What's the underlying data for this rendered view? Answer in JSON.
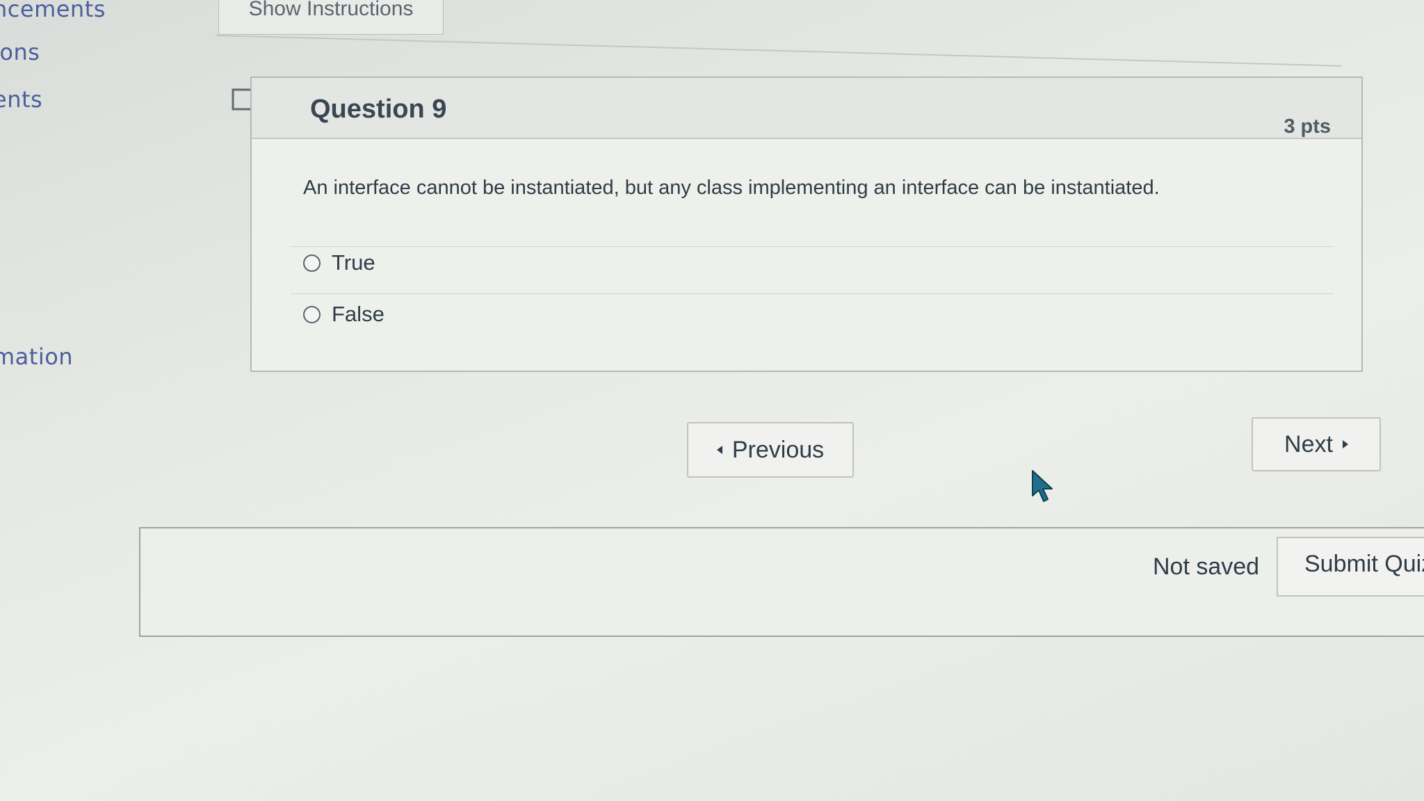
{
  "sidebar": {
    "items": [
      {
        "label": "ncements"
      },
      {
        "label": "ions"
      },
      {
        "label": "ents"
      },
      {
        "label": "mation"
      }
    ]
  },
  "quiz": {
    "show_instructions_label": "Show Instructions",
    "question": {
      "title": "Question 9",
      "points": "3 pts",
      "text": "An interface cannot be instantiated, but any class implementing an interface can be instantiated.",
      "answers": [
        {
          "label": "True",
          "selected": false
        },
        {
          "label": "False",
          "selected": false
        }
      ]
    },
    "nav": {
      "previous_label": "Previous",
      "next_label": "Next"
    },
    "footer": {
      "status": "Not saved",
      "submit_label": "Submit Quiz"
    }
  },
  "colors": {
    "link": "#4a5f9c",
    "text": "#2d3b45",
    "cursor": "#1e6e8c"
  }
}
